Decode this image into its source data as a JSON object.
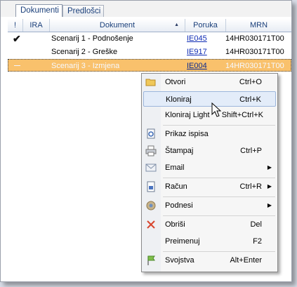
{
  "tabs": [
    {
      "label": "Dokumenti",
      "active": true
    },
    {
      "label": "Predlošci",
      "active": false
    }
  ],
  "columns": {
    "flag": "!",
    "ira": "IRA",
    "dokument": "Dokument",
    "poruka": "Poruka",
    "mrn": "MRN"
  },
  "rows": [
    {
      "status_icon": "check-icon",
      "dokument": "Scenarij 1 - Podnošenje",
      "poruka": "IE045",
      "mrn": "14HR030171T00"
    },
    {
      "status_icon": "",
      "dokument": "Scenarij 2 - Greške",
      "poruka": "IE917",
      "mrn": "14HR030171T00"
    },
    {
      "status_icon": "dash-icon",
      "dokument": "Scenarij 3 - Izmjena",
      "poruka": "IE004",
      "mrn": "14HR030171T00"
    }
  ],
  "menu": [
    {
      "label": "Otvori",
      "shortcut": "Ctrl+O",
      "icon": "folder-icon"
    },
    {
      "label": "Kloniraj",
      "shortcut": "Ctrl+K",
      "icon": "",
      "hover": true
    },
    {
      "label": "Kloniraj Light",
      "shortcut": "Shift+Ctrl+K",
      "icon": ""
    },
    {
      "label": "Prikaz ispisa",
      "shortcut": "",
      "icon": "print-preview-icon"
    },
    {
      "label": "Štampaj",
      "shortcut": "Ctrl+P",
      "icon": "printer-icon"
    },
    {
      "label": "Email",
      "shortcut": "",
      "icon": "email-icon",
      "submenu": true
    },
    {
      "label": "Račun",
      "shortcut": "Ctrl+R",
      "icon": "invoice-icon",
      "submenu": true
    },
    {
      "label": "Podnesi",
      "shortcut": "",
      "icon": "submit-icon",
      "submenu": true
    },
    {
      "label": "Obriši",
      "shortcut": "Del",
      "icon": "delete-icon"
    },
    {
      "label": "Preimenuj",
      "shortcut": "F2",
      "icon": ""
    },
    {
      "label": "Svojstva",
      "shortcut": "Alt+Enter",
      "icon": "flag-icon"
    }
  ],
  "colors": {
    "selected_row": "#f9c16c",
    "menu_hover": "#e3ecf9",
    "link": "#0f2cb4"
  }
}
